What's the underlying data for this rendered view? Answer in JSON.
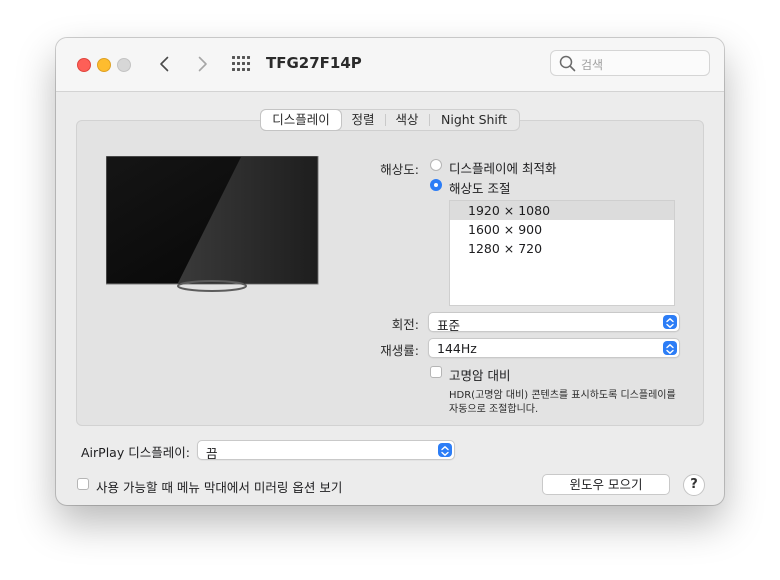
{
  "window": {
    "title": "TFG27F14P"
  },
  "search": {
    "placeholder": "검색"
  },
  "tabs": [
    {
      "label": "디스플레이",
      "selected": true
    },
    {
      "label": "정렬",
      "selected": false
    },
    {
      "label": "색상",
      "selected": false
    },
    {
      "label": "Night Shift",
      "selected": false
    }
  ],
  "resolution": {
    "label": "해상도:",
    "options": [
      {
        "label": "디스플레이에 최적화",
        "selected": false
      },
      {
        "label": "해상도 조절",
        "selected": true
      }
    ],
    "list": [
      {
        "label": "1920 × 1080",
        "selected": true
      },
      {
        "label": "1600 × 900",
        "selected": false
      },
      {
        "label": "1280 × 720",
        "selected": false
      }
    ]
  },
  "rotation": {
    "label": "회전:",
    "value": "표준"
  },
  "refresh_rate": {
    "label": "재생률:",
    "value": "144Hz"
  },
  "hdr": {
    "label": "고명암 대비",
    "checked": false,
    "note_line1": "HDR(고명암 대비) 콘텐츠를 표시하도록 디스플레이를",
    "note_line2": "자동으로 조절합니다."
  },
  "airplay": {
    "label": "AirPlay 디스플레이:",
    "value": "끔"
  },
  "mirroring": {
    "label": "사용 가능할 때 메뉴 막대에서 미러링 옵션 보기",
    "checked": false
  },
  "gather_windows": {
    "label": "윈도우 모으기"
  },
  "help": {
    "label": "?"
  },
  "colors": {
    "accent": "#2c7df6",
    "close": "#fe5f57",
    "minimize": "#febc2e"
  }
}
